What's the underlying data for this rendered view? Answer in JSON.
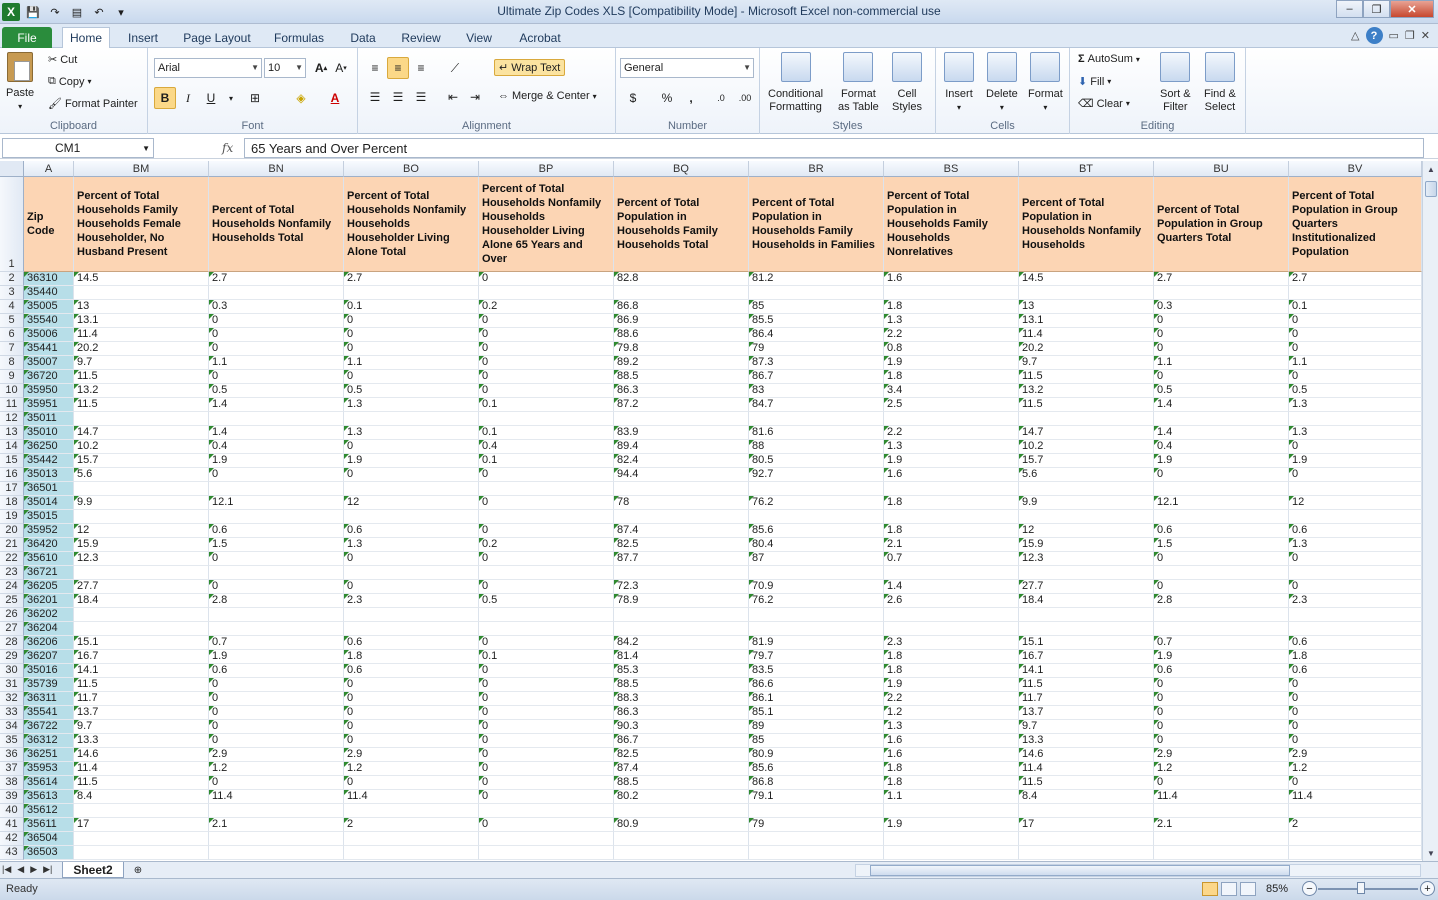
{
  "window": {
    "title": "Ultimate Zip Codes XLS  [Compatibility Mode]  -  Microsoft Excel non-commercial use",
    "minimize": "–",
    "restore": "❐",
    "close": "✕"
  },
  "tabs": [
    "File",
    "Home",
    "Insert",
    "Page Layout",
    "Formulas",
    "Data",
    "Review",
    "View",
    "Acrobat"
  ],
  "ribbon": {
    "clipboard": {
      "paste": "Paste",
      "cut": "Cut",
      "copy": "Copy",
      "format_painter": "Format Painter",
      "label": "Clipboard"
    },
    "font": {
      "name": "Arial",
      "size": "10",
      "bold": "B",
      "italic": "I",
      "underline": "U",
      "label": "Font"
    },
    "alignment": {
      "wrap_text": "Wrap Text",
      "merge_center": "Merge & Center",
      "label": "Alignment"
    },
    "number": {
      "format": "General",
      "currency": "$",
      "percent": "%",
      "comma": ",",
      "label": "Number"
    },
    "styles": {
      "conditional": "Conditional",
      "conditional2": "Formatting",
      "format_table": "Format",
      "format_table2": "as Table",
      "cell_styles": "Cell",
      "cell_styles2": "Styles",
      "label": "Styles"
    },
    "cells": {
      "insert": "Insert",
      "delete": "Delete",
      "format": "Format",
      "label": "Cells"
    },
    "editing": {
      "autosum": "AutoSum",
      "fill": "Fill",
      "clear": "Clear",
      "sort": "Sort &",
      "sort2": "Filter",
      "find": "Find &",
      "find2": "Select",
      "label": "Editing"
    }
  },
  "formula_bar": {
    "name_box": "CM1",
    "fx": "fx",
    "formula": "65 Years and Over Percent"
  },
  "columns": [
    "A",
    "BM",
    "BN",
    "BO",
    "BP",
    "BQ",
    "BR",
    "BS",
    "BT",
    "BU",
    "BV"
  ],
  "headers": [
    "Zip Code",
    "Percent of Total Households Family Households Female Householder, No Husband Present",
    "Percent of Total Households Nonfamily Households Total",
    "Percent of Total Households Nonfamily Households Householder Living Alone Total",
    "Percent of Total Households Nonfamily Households Householder Living Alone 65 Years and Over",
    "Percent of Total Population in Households Family Households Total",
    "Percent of Total Population in Households Family Households in Families",
    "Percent of Total Population in Households Family Households Nonrelatives",
    "Percent of Total Population in Households Nonfamily Households",
    "Percent of Total Population in Group Quarters Total",
    "Percent of Total Population in Group Quarters Institutionalized Population"
  ],
  "rows": [
    [
      "2",
      "36310",
      "14.5",
      "2.7",
      "2.7",
      "0",
      "82.8",
      "81.2",
      "1.6",
      "14.5",
      "2.7",
      "2.7"
    ],
    [
      "3",
      "35440",
      "",
      "",
      "",
      "",
      "",
      "",
      "",
      "",
      "",
      ""
    ],
    [
      "4",
      "35005",
      "13",
      "0.3",
      "0.1",
      "0.2",
      "86.8",
      "85",
      "1.8",
      "13",
      "0.3",
      "0.1"
    ],
    [
      "5",
      "35540",
      "13.1",
      "0",
      "0",
      "0",
      "86.9",
      "85.5",
      "1.3",
      "13.1",
      "0",
      "0"
    ],
    [
      "6",
      "35006",
      "11.4",
      "0",
      "0",
      "0",
      "88.6",
      "86.4",
      "2.2",
      "11.4",
      "0",
      "0"
    ],
    [
      "7",
      "35441",
      "20.2",
      "0",
      "0",
      "0",
      "79.8",
      "79",
      "0.8",
      "20.2",
      "0",
      "0"
    ],
    [
      "8",
      "35007",
      "9.7",
      "1.1",
      "1.1",
      "0",
      "89.2",
      "87.3",
      "1.9",
      "9.7",
      "1.1",
      "1.1"
    ],
    [
      "9",
      "36720",
      "11.5",
      "0",
      "0",
      "0",
      "88.5",
      "86.7",
      "1.8",
      "11.5",
      "0",
      "0"
    ],
    [
      "10",
      "35950",
      "13.2",
      "0.5",
      "0.5",
      "0",
      "86.3",
      "83",
      "3.4",
      "13.2",
      "0.5",
      "0.5"
    ],
    [
      "11",
      "35951",
      "11.5",
      "1.4",
      "1.3",
      "0.1",
      "87.2",
      "84.7",
      "2.5",
      "11.5",
      "1.4",
      "1.3"
    ],
    [
      "12",
      "35011",
      "",
      "",
      "",
      "",
      "",
      "",
      "",
      "",
      "",
      ""
    ],
    [
      "13",
      "35010",
      "14.7",
      "1.4",
      "1.3",
      "0.1",
      "83.9",
      "81.6",
      "2.2",
      "14.7",
      "1.4",
      "1.3"
    ],
    [
      "14",
      "36250",
      "10.2",
      "0.4",
      "0",
      "0.4",
      "89.4",
      "88",
      "1.3",
      "10.2",
      "0.4",
      "0"
    ],
    [
      "15",
      "35442",
      "15.7",
      "1.9",
      "1.9",
      "0.1",
      "82.4",
      "80.5",
      "1.9",
      "15.7",
      "1.9",
      "1.9"
    ],
    [
      "16",
      "35013",
      "5.6",
      "0",
      "0",
      "0",
      "94.4",
      "92.7",
      "1.6",
      "5.6",
      "0",
      "0"
    ],
    [
      "17",
      "36501",
      "",
      "",
      "",
      "",
      "",
      "",
      "",
      "",
      "",
      ""
    ],
    [
      "18",
      "35014",
      "9.9",
      "12.1",
      "12",
      "0",
      "78",
      "76.2",
      "1.8",
      "9.9",
      "12.1",
      "12"
    ],
    [
      "19",
      "35015",
      "",
      "",
      "",
      "",
      "",
      "",
      "",
      "",
      "",
      ""
    ],
    [
      "20",
      "35952",
      "12",
      "0.6",
      "0.6",
      "0",
      "87.4",
      "85.6",
      "1.8",
      "12",
      "0.6",
      "0.6"
    ],
    [
      "21",
      "36420",
      "15.9",
      "1.5",
      "1.3",
      "0.2",
      "82.5",
      "80.4",
      "2.1",
      "15.9",
      "1.5",
      "1.3"
    ],
    [
      "22",
      "35610",
      "12.3",
      "0",
      "0",
      "0",
      "87.7",
      "87",
      "0.7",
      "12.3",
      "0",
      "0"
    ],
    [
      "23",
      "36721",
      "",
      "",
      "",
      "",
      "",
      "",
      "",
      "",
      "",
      ""
    ],
    [
      "24",
      "36205",
      "27.7",
      "0",
      "0",
      "0",
      "72.3",
      "70.9",
      "1.4",
      "27.7",
      "0",
      "0"
    ],
    [
      "25",
      "36201",
      "18.4",
      "2.8",
      "2.3",
      "0.5",
      "78.9",
      "76.2",
      "2.6",
      "18.4",
      "2.8",
      "2.3"
    ],
    [
      "26",
      "36202",
      "",
      "",
      "",
      "",
      "",
      "",
      "",
      "",
      "",
      ""
    ],
    [
      "27",
      "36204",
      "",
      "",
      "",
      "",
      "",
      "",
      "",
      "",
      "",
      ""
    ],
    [
      "28",
      "36206",
      "15.1",
      "0.7",
      "0.6",
      "0",
      "84.2",
      "81.9",
      "2.3",
      "15.1",
      "0.7",
      "0.6"
    ],
    [
      "29",
      "36207",
      "16.7",
      "1.9",
      "1.8",
      "0.1",
      "81.4",
      "79.7",
      "1.8",
      "16.7",
      "1.9",
      "1.8"
    ],
    [
      "30",
      "35016",
      "14.1",
      "0.6",
      "0.6",
      "0",
      "85.3",
      "83.5",
      "1.8",
      "14.1",
      "0.6",
      "0.6"
    ],
    [
      "31",
      "35739",
      "11.5",
      "0",
      "0",
      "0",
      "88.5",
      "86.6",
      "1.9",
      "11.5",
      "0",
      "0"
    ],
    [
      "32",
      "36311",
      "11.7",
      "0",
      "0",
      "0",
      "88.3",
      "86.1",
      "2.2",
      "11.7",
      "0",
      "0"
    ],
    [
      "33",
      "35541",
      "13.7",
      "0",
      "0",
      "0",
      "86.3",
      "85.1",
      "1.2",
      "13.7",
      "0",
      "0"
    ],
    [
      "34",
      "36722",
      "9.7",
      "0",
      "0",
      "0",
      "90.3",
      "89",
      "1.3",
      "9.7",
      "0",
      "0"
    ],
    [
      "35",
      "36312",
      "13.3",
      "0",
      "0",
      "0",
      "86.7",
      "85",
      "1.6",
      "13.3",
      "0",
      "0"
    ],
    [
      "36",
      "36251",
      "14.6",
      "2.9",
      "2.9",
      "0",
      "82.5",
      "80.9",
      "1.6",
      "14.6",
      "2.9",
      "2.9"
    ],
    [
      "37",
      "35953",
      "11.4",
      "1.2",
      "1.2",
      "0",
      "87.4",
      "85.6",
      "1.8",
      "11.4",
      "1.2",
      "1.2"
    ],
    [
      "38",
      "35614",
      "11.5",
      "0",
      "0",
      "0",
      "88.5",
      "86.8",
      "1.8",
      "11.5",
      "0",
      "0"
    ],
    [
      "39",
      "35613",
      "8.4",
      "11.4",
      "11.4",
      "0",
      "80.2",
      "79.1",
      "1.1",
      "8.4",
      "11.4",
      "11.4"
    ],
    [
      "40",
      "35612",
      "",
      "",
      "",
      "",
      "",
      "",
      "",
      "",
      "",
      ""
    ],
    [
      "41",
      "35611",
      "17",
      "2.1",
      "2",
      "0",
      "80.9",
      "79",
      "1.9",
      "17",
      "2.1",
      "2"
    ],
    [
      "42",
      "36504",
      "",
      "",
      "",
      "",
      "",
      "",
      "",
      "",
      "",
      ""
    ],
    [
      "43",
      "36503",
      "",
      "",
      "",
      "",
      "",
      "",
      "",
      "",
      "",
      ""
    ]
  ],
  "sheet_tab": "Sheet2",
  "status": {
    "ready": "Ready",
    "zoom": "85%"
  },
  "colors": {
    "header_fill": "#fcd5b4",
    "zip_fill": "#b7dee8",
    "file_tab": "#2a8c3c"
  }
}
